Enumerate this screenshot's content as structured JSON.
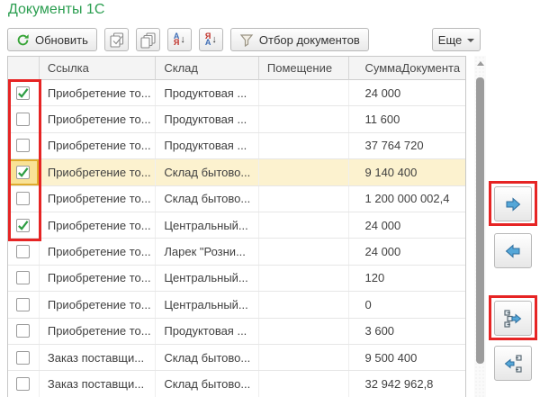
{
  "title": "Документы 1С",
  "toolbar": {
    "refresh_label": "Обновить",
    "filter_label": "Отбор документов",
    "more_label": "Еще"
  },
  "icons": {
    "refresh": "refresh-circular-arrow",
    "set_all_checkboxes": "stacked-pages-green-check",
    "clear_all_checkboxes": "stacked-pages",
    "sort_asc": {
      "top": "А",
      "bottom": "Я",
      "arrow": "↓"
    },
    "sort_desc": {
      "top": "Я",
      "bottom": "А",
      "arrow": "↓"
    },
    "filter": "funnel",
    "more_caret": "dropdown-triangle"
  },
  "table": {
    "columns": [
      "Ссылка",
      "Склад",
      "Помещение",
      "СуммаДокумента"
    ],
    "rows": [
      {
        "checked": true,
        "selected": false,
        "ssylka": "Приобретение то...",
        "sklad": "Продуктовая ...",
        "pomeshchenie": "",
        "summa": "24 000"
      },
      {
        "checked": false,
        "selected": false,
        "ssylka": "Приобретение то...",
        "sklad": "Продуктовая ...",
        "pomeshchenie": "",
        "summa": "11 600"
      },
      {
        "checked": false,
        "selected": false,
        "ssylka": "Приобретение то...",
        "sklad": "Продуктовая ...",
        "pomeshchenie": "",
        "summa": "37 764 720"
      },
      {
        "checked": true,
        "selected": true,
        "ssylka": "Приобретение то...",
        "sklad": "Склад бытово...",
        "pomeshchenie": "",
        "summa": "9 140 400"
      },
      {
        "checked": false,
        "selected": false,
        "ssylka": "Приобретение то...",
        "sklad": "Склад бытово...",
        "pomeshchenie": "",
        "summa": "1 200 000 002,4"
      },
      {
        "checked": true,
        "selected": false,
        "ssylka": "Приобретение то...",
        "sklad": "Центральный...",
        "pomeshchenie": "",
        "summa": "24 000"
      },
      {
        "checked": false,
        "selected": false,
        "ssylka": "Приобретение то...",
        "sklad": "Ларек \"Розни...",
        "pomeshchenie": "",
        "summa": "24 000"
      },
      {
        "checked": false,
        "selected": false,
        "ssylka": "Приобретение то...",
        "sklad": "Центральный...",
        "pomeshchenie": "",
        "summa": "120"
      },
      {
        "checked": false,
        "selected": false,
        "ssylka": "Приобретение то...",
        "sklad": "Центральный...",
        "pomeshchenie": "",
        "summa": "0"
      },
      {
        "checked": false,
        "selected": false,
        "ssylka": "Приобретение то...",
        "sklad": "Продуктовая ...",
        "pomeshchenie": "",
        "summa": "3 600"
      },
      {
        "checked": false,
        "selected": false,
        "ssylka": "Заказ поставщи...",
        "sklad": "Склад бытово...",
        "pomeshchenie": "",
        "summa": "9 500 400"
      },
      {
        "checked": false,
        "selected": false,
        "ssylka": "Заказ поставщи...",
        "sklad": "Склад бытово...",
        "pomeshchenie": "",
        "summa": "32 942 962,8"
      }
    ]
  },
  "side_buttons": [
    {
      "name": "move-right",
      "icon": "arrow-right"
    },
    {
      "name": "move-left",
      "icon": "arrow-left"
    },
    {
      "name": "move-all-right",
      "icon": "list-with-arrow-right"
    },
    {
      "name": "move-all-left",
      "icon": "arrow-left-with-list"
    }
  ],
  "annotations": [
    {
      "shape": "red-rectangle",
      "target": "checkbox-column-rows-1-6"
    },
    {
      "shape": "red-rectangle",
      "target": "move-right-button"
    },
    {
      "shape": "red-rectangle",
      "target": "move-all-right-button"
    }
  ],
  "colors": {
    "title_green": "#2b9e50",
    "check_green": "#2f9e44",
    "annotation_red": "#e62424",
    "selected_row_yellow": "#fcf2cf",
    "current_cell_yellow": "#f9e296",
    "arrow_blue": "#55a7d8"
  }
}
